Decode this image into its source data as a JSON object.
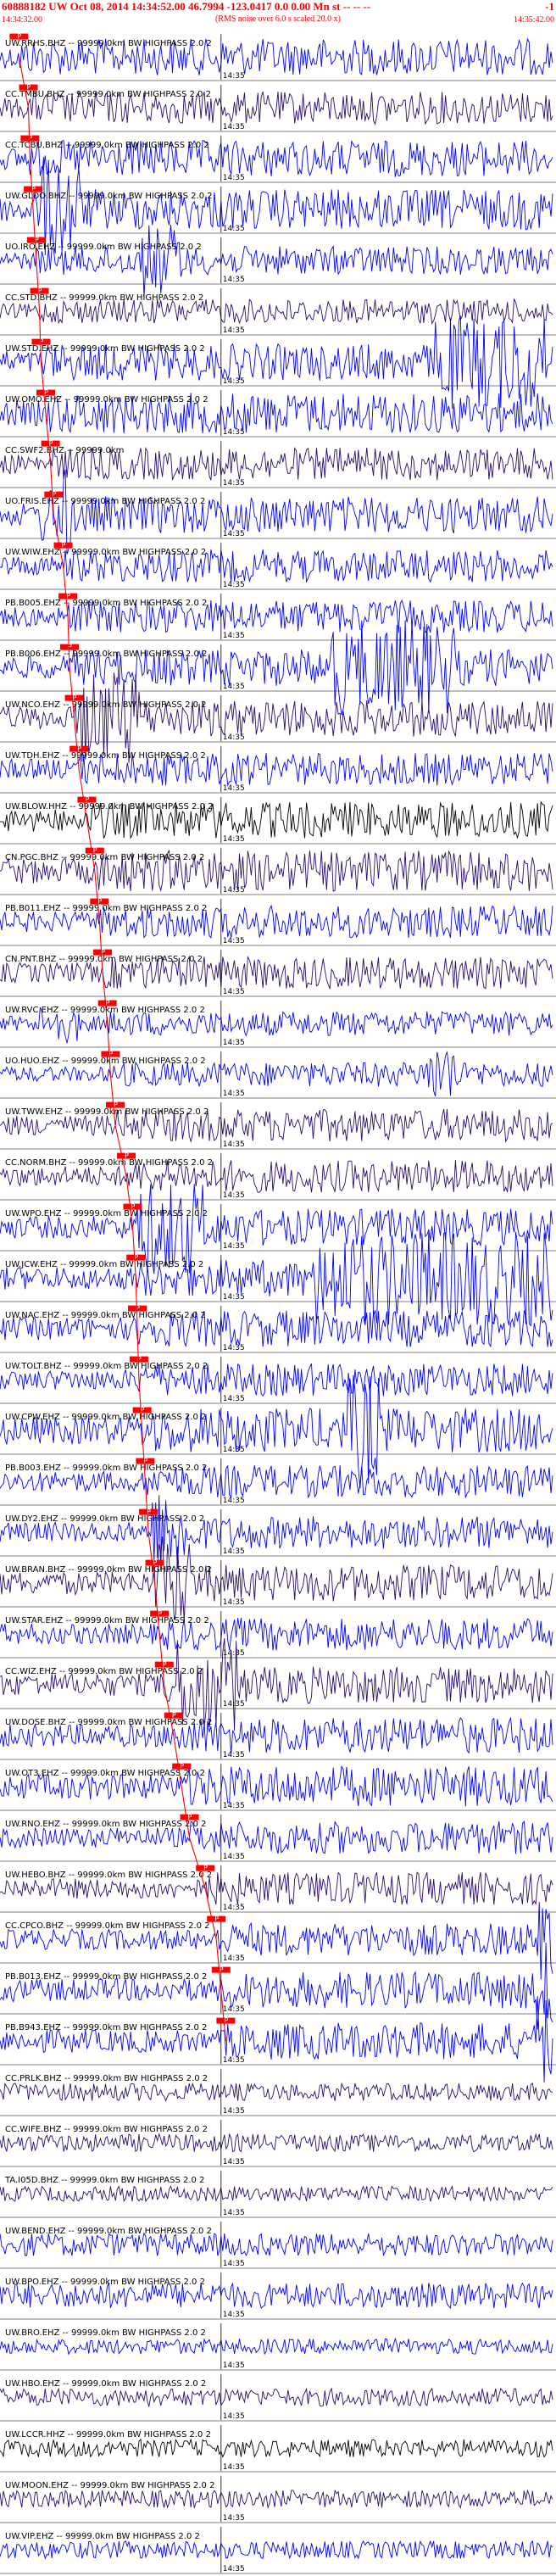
{
  "header": {
    "title": "60888182 UW Oct 08, 2014 14:34:52.00   46.7994 -123.0417  0.0 0.00 Mn st -- -- --",
    "number": "-1",
    "subtitle": "(RMS noise over 6.0 s scaled 20.0 x)",
    "time_start": "14:34:32.00",
    "time_end": "14:35:42.00"
  },
  "chart_data": {
    "type": "line",
    "title": "60888182 UW Oct 08, 2014 14:34:52.00   46.7994 -123.0417  0.0 0.00 Mn st -- -- --",
    "x_range": [
      "14:34:32.00",
      "14:35:42.00"
    ],
    "x_tick_label": "14:35",
    "grid": false,
    "trace_colors": {
      "primary": "#0000ff",
      "alt": "#2a0a6e",
      "black": "#000000"
    },
    "pick_color": "#ff0000",
    "stations": [
      {
        "label": "UW.RRHS.BHZ -- 99999.0km BW  HIGHPASS  2.0  2",
        "pick": "P",
        "pick_t": 2.4,
        "color": "blue",
        "amp": 0.45,
        "burst": null
      },
      {
        "label": "CC.TMBU.BHZ -- 99999.0km BW  HIGHPASS  2.0  2",
        "pick": "P",
        "pick_t": 3.6,
        "color": "alt",
        "amp": 0.4,
        "burst": null
      },
      {
        "label": "CC.TCBU.BHZ -- 99999.0km BW  HIGHPASS  2.0  2",
        "pick": "P",
        "pick_t": 3.8,
        "color": "blue",
        "amp": 0.45,
        "burst": null
      },
      {
        "label": "UW.GLDO.BHZ -- 99999.0km BW  HIGHPASS  2.0  2",
        "pick": "P",
        "pick_t": 4.2,
        "color": "blue",
        "amp": 0.5,
        "burst": [
          5.0,
          10.0
        ]
      },
      {
        "label": "UO.IRO.EHZ -- 99999.0km BW  HIGHPASS  2.0  2",
        "pick": "P",
        "pick_t": 4.6,
        "color": "blue",
        "amp": 0.35,
        "burst": [
          18.0,
          23.0
        ]
      },
      {
        "label": "CC.STD.BHZ -- 99999.0km BW  HIGHPASS  2.0  2",
        "pick": "P",
        "pick_t": 5.0,
        "color": "alt",
        "amp": 0.3,
        "burst": null
      },
      {
        "label": "UW.STD.EHZ -- 99999.0km BW  HIGHPASS  2.0  2",
        "pick": "P",
        "pick_t": 5.2,
        "color": "blue",
        "amp": 0.45,
        "burst": [
          55.0,
          69.0
        ]
      },
      {
        "label": "UW.OMO.EHZ -- 99999.0km BW  HIGHPASS  2.0  2",
        "pick": "P",
        "pick_t": 5.8,
        "color": "blue",
        "amp": 0.5,
        "burst": null
      },
      {
        "label": "CC.SWF2.BHZ -- 99999.0km",
        "pick": "P",
        "pick_t": 6.4,
        "color": "alt",
        "amp": 0.4,
        "burst": null
      },
      {
        "label": "UO.FRIS.EHZ -- 99999.0km BW  HIGHPASS  2.0  2",
        "pick": "P",
        "pick_t": 6.8,
        "color": "blue",
        "amp": 0.45,
        "burst": [
          5.0,
          9.0
        ]
      },
      {
        "label": "UW.WIW.EHZ -- 99999.0km BW  HIGHPASS  2.0  2",
        "pick": "P",
        "pick_t": 8.0,
        "color": "blue",
        "amp": 0.4,
        "burst": null
      },
      {
        "label": "PB.B005.EHZ -- 99999.0km BW  HIGHPASS  2.0  2",
        "pick": "P",
        "pick_t": 8.6,
        "color": "blue",
        "amp": 0.4,
        "burst": null
      },
      {
        "label": "PB.B006.EHZ -- 99999.0km BW  HIGHPASS  2.0  2",
        "pick": "P",
        "pick_t": 8.8,
        "color": "blue",
        "amp": 0.45,
        "burst": [
          42.0,
          58.0
        ]
      },
      {
        "label": "UW.NCO.EHZ -- 99999.0km BW  HIGHPASS  2.0  2",
        "pick": "P",
        "pick_t": 9.4,
        "color": "alt",
        "amp": 0.45,
        "burst": [
          10.0,
          18.0
        ]
      },
      {
        "label": "UW.TDH.EHZ -- 99999.0km BW  HIGHPASS  2.0  2",
        "pick": "P",
        "pick_t": 10.0,
        "color": "blue",
        "amp": 0.4,
        "burst": null
      },
      {
        "label": "UW.BLOW.HHZ -- 99999.0km BW  HIGHPASS  2.0  2",
        "pick": "P",
        "pick_t": 11.0,
        "color": "black",
        "amp": 0.45,
        "burst": null
      },
      {
        "label": "CN.PGC.BHZ -- 99999.0km BW  HIGHPASS  2.0  2",
        "pick": "P",
        "pick_t": 12.0,
        "color": "alt",
        "amp": 0.5,
        "burst": null
      },
      {
        "label": "PB.B011.EHZ -- 99999.0km BW  HIGHPASS  2.0  2",
        "pick": "P",
        "pick_t": 12.6,
        "color": "blue",
        "amp": 0.4,
        "burst": null
      },
      {
        "label": "CN.PNT.BHZ -- 99999.0km BW  HIGHPASS  2.0  2",
        "pick": "P",
        "pick_t": 13.0,
        "color": "alt",
        "amp": 0.4,
        "burst": null
      },
      {
        "label": "UW.RVC.EHZ -- 99999.0km BW  HIGHPASS  2.0  2",
        "pick": "P",
        "pick_t": 13.6,
        "color": "blue",
        "amp": 0.3,
        "burst": [
          5.0,
          10.0
        ]
      },
      {
        "label": "UO.HUO.EHZ -- 99999.0km BW  HIGHPASS  2.0  2",
        "pick": "P",
        "pick_t": 14.0,
        "color": "blue",
        "amp": 0.3,
        "burst": [
          54.0,
          58.0
        ]
      },
      {
        "label": "UW.TWW.EHZ -- 99999.0km BW  HIGHPASS  2.0  2",
        "pick": "P",
        "pick_t": 14.6,
        "color": "alt",
        "amp": 0.4,
        "burst": null
      },
      {
        "label": "CC.NORM.BHZ -- 99999.0km BW  HIGHPASS  2.0  2",
        "pick": "P",
        "pick_t": 16.0,
        "color": "alt",
        "amp": 0.4,
        "burst": null
      },
      {
        "label": "UW.WPO.EHZ -- 99999.0km BW  HIGHPASS  2.0  2",
        "pick": "P",
        "pick_t": 16.8,
        "color": "blue",
        "amp": 0.45,
        "burst": [
          17.0,
          26.0
        ]
      },
      {
        "label": "UW.JCW.EHZ -- 99999.0km BW  HIGHPASS  2.0  2",
        "pick": "P",
        "pick_t": 17.2,
        "color": "blue",
        "amp": 0.45,
        "burst": [
          40.0,
          70.0
        ]
      },
      {
        "label": "UW.NAC.EHZ -- 99999.0km BW  HIGHPASS  2.0  2",
        "pick": "P",
        "pick_t": 17.4,
        "color": "blue",
        "amp": 0.45,
        "burst": null
      },
      {
        "label": "UW.TOLT.BHZ -- 99999.0km BW  HIGHPASS  2.0  2",
        "pick": "P",
        "pick_t": 17.6,
        "color": "blue",
        "amp": 0.4,
        "burst": null
      },
      {
        "label": "UW.CPW.EHZ -- 99999.0km BW  HIGHPASS  2.0  2",
        "pick": "P",
        "pick_t": 18.0,
        "color": "blue",
        "amp": 0.55,
        "burst": [
          44.0,
          48.0
        ]
      },
      {
        "label": "PB.B003.EHZ -- 99999.0km BW  HIGHPASS  2.0  2",
        "pick": "P",
        "pick_t": 18.4,
        "color": "blue",
        "amp": 0.4,
        "burst": null
      },
      {
        "label": "UW.DY2.EHZ -- 99999.0km BW  HIGHPASS  2.0  2",
        "pick": "P",
        "pick_t": 18.8,
        "color": "blue",
        "amp": 0.4,
        "burst": [
          19.0,
          24.0
        ]
      },
      {
        "label": "UW.BRAN.BHZ -- 99999.0km BW  HIGHPASS  2.0  2",
        "pick": "P",
        "pick_t": 19.6,
        "color": "alt",
        "amp": 0.45,
        "burst": [
          19.0,
          24.0
        ]
      },
      {
        "label": "UW.STAR.EHZ -- 99999.0km BW  HIGHPASS  2.0  2",
        "pick": "P",
        "pick_t": 20.2,
        "color": "blue",
        "amp": 0.4,
        "burst": null
      },
      {
        "label": "CC.WIZ.EHZ -- 99999.0km BW  HIGHPASS  2.0  2",
        "pick": "P",
        "pick_t": 20.8,
        "color": "alt",
        "amp": 0.45,
        "burst": [
          21.0,
          30.0
        ]
      },
      {
        "label": "UW.DOSE.BHZ -- 99999.0km BW  HIGHPASS  2.0  2",
        "pick": "P",
        "pick_t": 22.0,
        "color": "blue",
        "amp": 0.45,
        "burst": null
      },
      {
        "label": "UW.OT3.EHZ -- 99999.0km BW  HIGHPASS  2.0  2",
        "pick": "P",
        "pick_t": 23.0,
        "color": "blue",
        "amp": 0.5,
        "burst": null
      },
      {
        "label": "UW.RNO.EHZ -- 99999.0km BW  HIGHPASS  2.0  2",
        "pick": "P",
        "pick_t": 24.0,
        "color": "blue",
        "amp": 0.4,
        "burst": null
      },
      {
        "label": "UW.HEBO.BHZ -- 99999.0km BW  HIGHPASS  2.0  2",
        "pick": "P",
        "pick_t": 26.0,
        "color": "alt",
        "amp": 0.4,
        "burst": null
      },
      {
        "label": "CC.CPCO.BHZ -- 99999.0km BW  HIGHPASS  2.0  2",
        "pick": "P",
        "pick_t": 27.4,
        "color": "blue",
        "amp": 0.4,
        "burst": [
          68.0,
          70.0
        ]
      },
      {
        "label": "PB.B013.EHZ -- 99999.0km BW  HIGHPASS  2.0  2",
        "pick": "P",
        "pick_t": 28.0,
        "color": "blue",
        "amp": 0.45,
        "burst": [
          68.0,
          70.0
        ]
      },
      {
        "label": "PB.B943.EHZ -- 99999.0km BW  HIGHPASS  2.0  2",
        "pick": "P",
        "pick_t": 28.6,
        "color": "blue",
        "amp": 0.45,
        "burst": [
          68.0,
          70.0
        ]
      },
      {
        "label": "CC.PRLK.BHZ -- 99999.0km BW  HIGHPASS  2.0  2",
        "pick": null,
        "pick_t": null,
        "color": "alt",
        "amp": 0.35,
        "burst": null
      },
      {
        "label": "CC.WIFE.BHZ -- 99999.0km BW  HIGHPASS  2.0  2",
        "pick": null,
        "pick_t": null,
        "color": "alt",
        "amp": 0.35,
        "burst": null
      },
      {
        "label": "TA.I05D.BHZ -- 99999.0km BW  HIGHPASS  2.0  2",
        "pick": null,
        "pick_t": null,
        "color": "alt",
        "amp": 0.3,
        "burst": null
      },
      {
        "label": "UW.BEND.EHZ -- 99999.0km BW  HIGHPASS  2.0  2",
        "pick": null,
        "pick_t": null,
        "color": "blue",
        "amp": 0.45,
        "burst": null
      },
      {
        "label": "UW.BPO.EHZ -- 99999.0km BW  HIGHPASS  2.0  2",
        "pick": null,
        "pick_t": null,
        "color": "blue",
        "amp": 0.5,
        "burst": null
      },
      {
        "label": "UW.BRO.EHZ -- 99999.0km BW  HIGHPASS  2.0  2",
        "pick": null,
        "pick_t": null,
        "color": "blue",
        "amp": 0.3,
        "burst": [
          53.4,
          53.8
        ]
      },
      {
        "label": "UW.HBO.EHZ -- 99999.0km BW  HIGHPASS  2.0  2",
        "pick": null,
        "pick_t": null,
        "color": "alt",
        "amp": 0.35,
        "burst": null
      },
      {
        "label": "UW.LCCR.HHZ -- 99999.0km BW  HIGHPASS  2.0  2",
        "pick": null,
        "pick_t": null,
        "color": "black",
        "amp": 0.35,
        "burst": null
      },
      {
        "label": "UW.MOON.EHZ -- 99999.0km BW  HIGHPASS  2.0  2",
        "pick": null,
        "pick_t": null,
        "color": "alt",
        "amp": 0.35,
        "burst": null
      },
      {
        "label": "UW.VIP.EHZ -- 99999.0km BW  HIGHPASS  2.0  2",
        "pick": null,
        "pick_t": null,
        "color": "blue",
        "amp": 0.35,
        "burst": null
      }
    ]
  }
}
